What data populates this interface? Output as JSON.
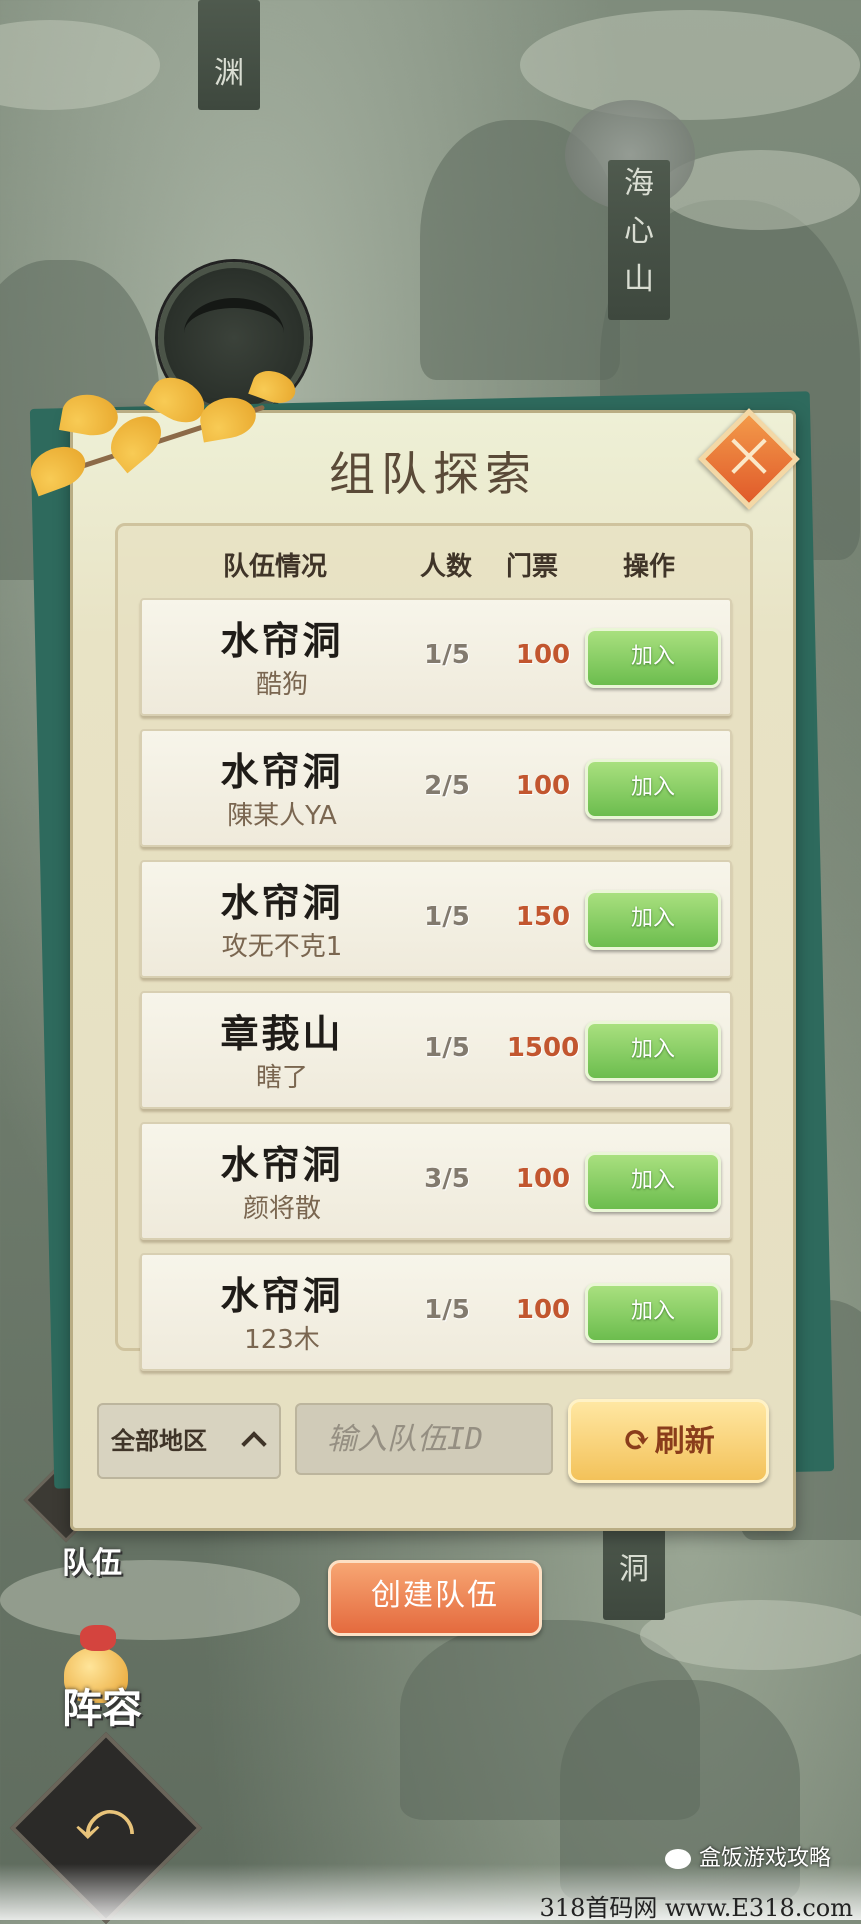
{
  "map": {
    "top_banner_char": "渊",
    "right_banner_chars": [
      "海",
      "心",
      "山"
    ],
    "lower_banner_char": "洞"
  },
  "dialog": {
    "title": "组队探索",
    "columns": {
      "team": "队伍情况",
      "members": "人数",
      "ticket": "门票",
      "action": "操作"
    },
    "teams": [
      {
        "location": "水帘洞",
        "leader": "酷狗",
        "members": "1/5",
        "ticket": "100",
        "action": "加入"
      },
      {
        "location": "水帘洞",
        "leader": "陳某人YA",
        "members": "2/5",
        "ticket": "100",
        "action": "加入"
      },
      {
        "location": "水帘洞",
        "leader": "攻无不克1",
        "members": "1/5",
        "ticket": "150",
        "action": "加入"
      },
      {
        "location": "章莪山",
        "leader": "瞎了",
        "members": "1/5",
        "ticket": "1500",
        "action": "加入"
      },
      {
        "location": "水帘洞",
        "leader": "颜将散",
        "members": "3/5",
        "ticket": "100",
        "action": "加入"
      },
      {
        "location": "水帘洞",
        "leader": "123木",
        "members": "1/5",
        "ticket": "100",
        "action": "加入"
      }
    ],
    "region_label": "全部地区",
    "id_placeholder": "输入队伍ID",
    "refresh_label": "刷新"
  },
  "create_team_label": "创建队伍",
  "side": {
    "team_label": "队伍",
    "lineup_label": "阵容"
  },
  "watermark": {
    "wechat": "盒饭游戏攻略",
    "site": "318首码网 www.E318.com"
  },
  "colors": {
    "join_button": "#6cbd4e",
    "ticket_text": "#c2562f",
    "refresh_button": "#f3c25a",
    "create_button": "#e46a3e",
    "panel_accent": "#2e6a5d"
  }
}
